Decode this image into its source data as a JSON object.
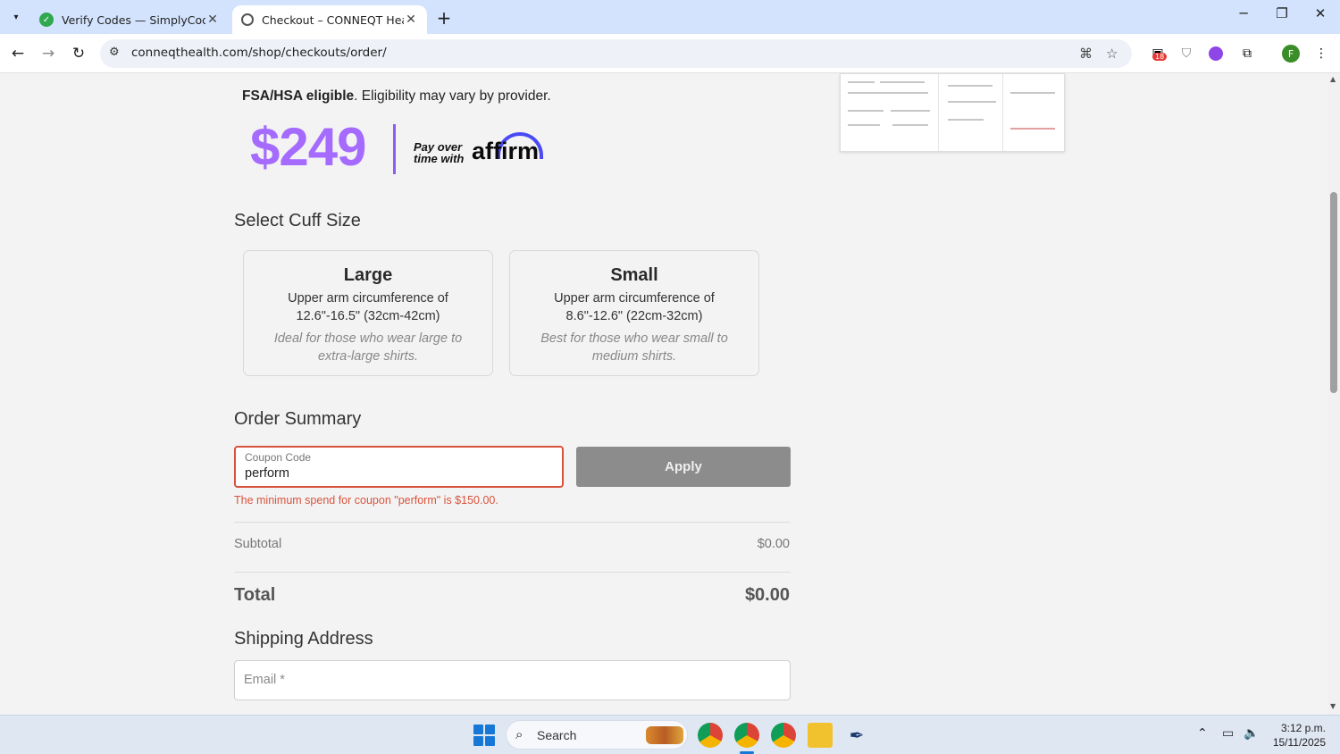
{
  "browser": {
    "tabs": [
      {
        "title": "Verify Codes — SimplyCodes",
        "active": false
      },
      {
        "title": "Checkout – CONNEQT Health S",
        "active": true
      }
    ],
    "url": "conneqthealth.com/shop/checkouts/order/",
    "extension_badge": "18",
    "profile_initial": "F"
  },
  "product": {
    "fsa_bold": "FSA/HSA eligible",
    "fsa_rest": ". Eligibility may vary by provider.",
    "price": "$249",
    "pay_over_line1": "Pay over",
    "pay_over_line2": "time with",
    "affirm": "affirm"
  },
  "cuff": {
    "heading": "Select Cuff Size",
    "options": [
      {
        "name": "Large",
        "desc": "Upper arm circumference of 12.6\"-16.5\" (32cm-42cm)",
        "note": "Ideal for those who wear large to extra-large shirts."
      },
      {
        "name": "Small",
        "desc": "Upper arm circumference of 8.6\"-12.6\" (22cm-32cm)",
        "note": "Best for those who wear small to medium shirts."
      }
    ]
  },
  "order": {
    "heading": "Order Summary",
    "coupon_label": "Coupon Code",
    "coupon_value": "perform",
    "apply_label": "Apply",
    "error": "The minimum spend for coupon \"perform\" is $150.00.",
    "subtotal_label": "Subtotal",
    "subtotal_value": "$0.00",
    "total_label": "Total",
    "total_value": "$0.00"
  },
  "shipping": {
    "heading": "Shipping Address",
    "email_placeholder": "Email *"
  },
  "taskbar": {
    "search_label": "Search",
    "time": "3:12 p.m.",
    "date": "15/11/2025"
  },
  "colors": {
    "price": "#a56bff",
    "affirm_arc": "#4a4af4",
    "error": "#d9533c",
    "apply_bg": "#8c8c8c",
    "chrome_tabstrip": "#d3e3fd"
  }
}
